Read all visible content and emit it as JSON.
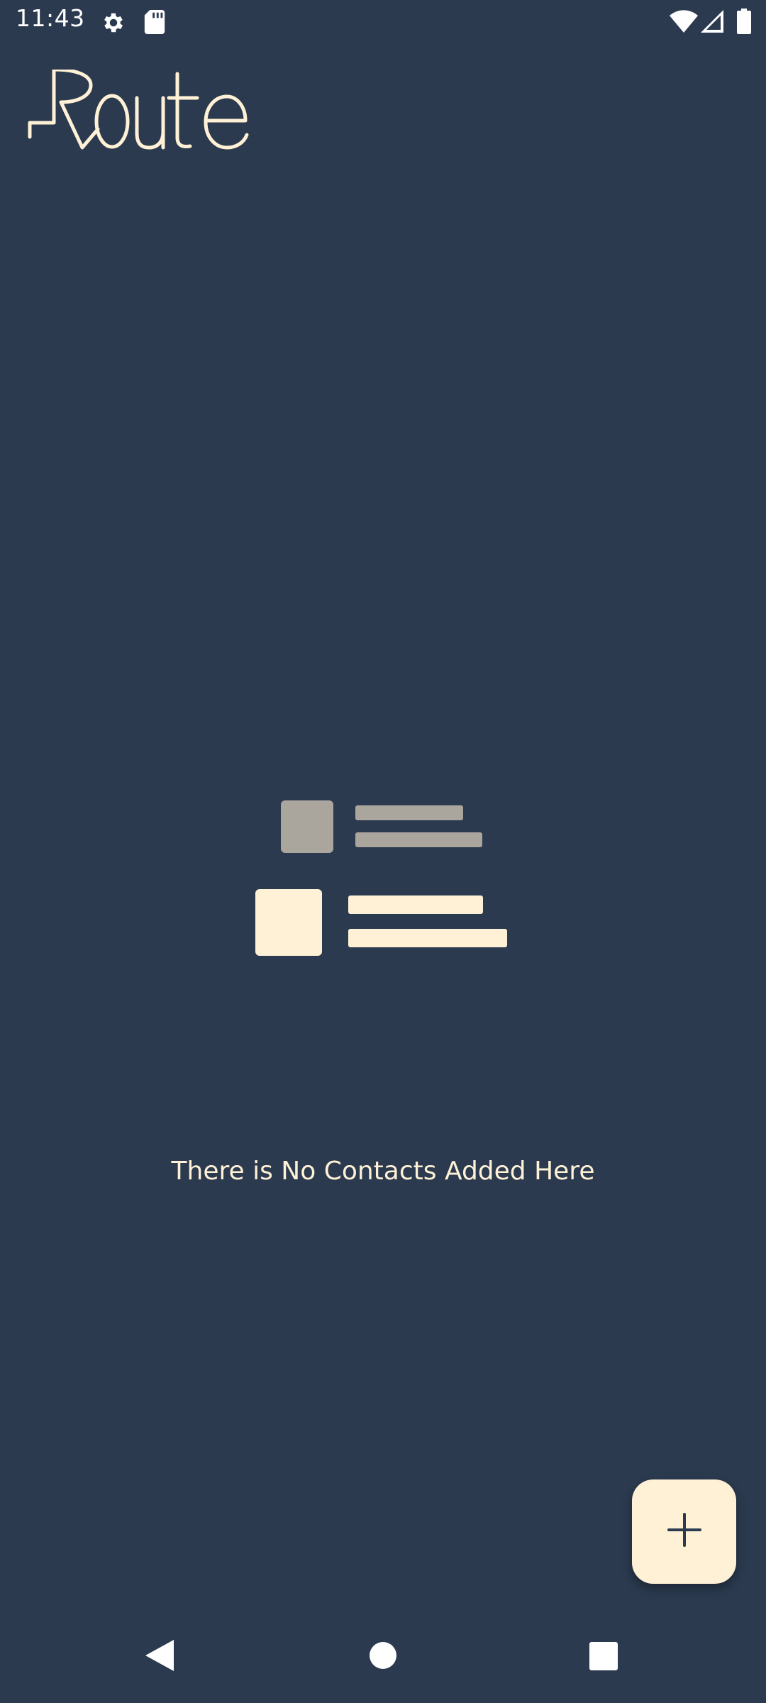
{
  "status_bar": {
    "time": "11:43",
    "icons": [
      "settings-icon",
      "sd-card-icon",
      "wifi-icon",
      "signal-icon",
      "battery-icon"
    ]
  },
  "app": {
    "logo_text": "Route"
  },
  "empty_state": {
    "message": "There is No Contacts Added Here"
  },
  "fab": {
    "icon": "plus-icon"
  },
  "navigation": {
    "buttons": [
      "back-icon",
      "home-icon",
      "recents-icon"
    ]
  },
  "colors": {
    "background": "#2b3a4f",
    "accent": "#fff1d6",
    "muted": "#aaa59d"
  }
}
